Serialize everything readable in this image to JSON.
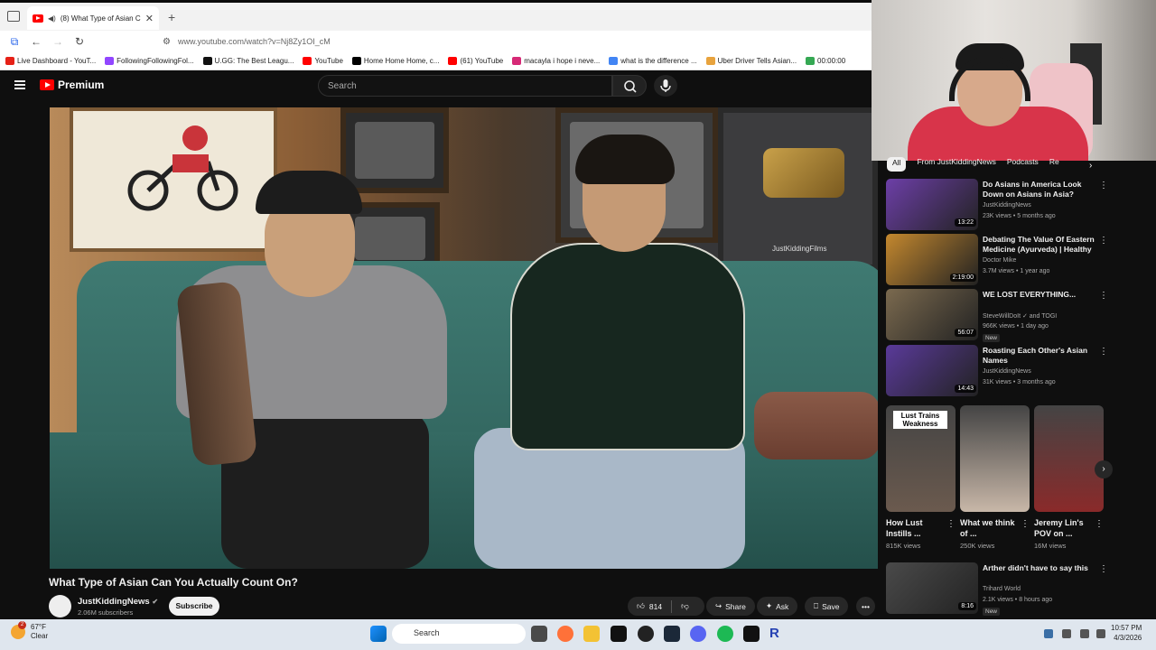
{
  "browser": {
    "tab_title": "(8) What Type of Asian Can",
    "url": "www.youtube.com/watch?v=Nj8Zy1OI_cM",
    "bookmarks": [
      {
        "label": "Live Dashboard - YouT...",
        "color": "#e62117"
      },
      {
        "label": "FollowingFollowingFol...",
        "color": "#9146ff"
      },
      {
        "label": "U.GG: The Best Leagu...",
        "color": "#111111"
      },
      {
        "label": "YouTube",
        "color": "#ff0000"
      },
      {
        "label": "Home Home Home, c...",
        "color": "#000000"
      },
      {
        "label": "(61) YouTube",
        "color": "#ff0000"
      },
      {
        "label": "macayla i hope i neve...",
        "color": "#d62976"
      },
      {
        "label": "what is the difference ...",
        "color": "#4285f4"
      },
      {
        "label": "Uber Driver Tells Asian...",
        "color": "#e8a33d"
      },
      {
        "label": "00:00:00",
        "color": "#35a853"
      }
    ]
  },
  "youtube": {
    "logo_text": "Premium",
    "search_placeholder": "Search"
  },
  "video": {
    "title": "What Type of Asian Can You Actually Count On?",
    "channel": "JustKiddingNews",
    "subscribers": "2.06M subscribers",
    "subscribe_label": "Subscribe",
    "likes": "814",
    "share_label": "Share",
    "ask_label": "Ask",
    "save_label": "Save",
    "overlay_text": "JustKiddingFilms"
  },
  "chips": [
    "All",
    "From JustKiddingNews",
    "Podcasts",
    "Re"
  ],
  "recommended": [
    {
      "title": "Do Asians in America Look Down on Asians in Asia?",
      "channel": "JustKiddingNews",
      "meta": "23K views • 5 months ago",
      "duration": "13:22",
      "thumb": "#6d3fa8",
      "new": ""
    },
    {
      "title": "Debating The Value Of Eastern Medicine (Ayurveda) | Healthy ...",
      "channel": "Doctor Mike",
      "meta": "3.7M views • 1 year ago",
      "duration": "2:19:00",
      "thumb": "#c4882e",
      "new": ""
    },
    {
      "title": "WE LOST EVERYTHING...",
      "channel": "SteveWillDoIt ✓ and TOGI",
      "meta": "966K views • 1 day ago",
      "duration": "56:07",
      "thumb": "#7b6a4f",
      "new": "New"
    },
    {
      "title": "Roasting Each Other's Asian Names",
      "channel": "JustKiddingNews",
      "meta": "31K views • 3 months ago",
      "duration": "14:43",
      "thumb": "#5a3a9a",
      "new": ""
    },
    {
      "title": "Arther didn't have to say this",
      "channel": "Trihard World",
      "meta": "2.1K views • 8 hours ago",
      "duration": "8:16",
      "thumb": "#4a4a4a",
      "new": "New"
    }
  ],
  "shorts": [
    {
      "title": "How Lust Instills ...",
      "views": "815K views",
      "overlay": "Lust Trains Weakness",
      "thumb": "#6b5a4e"
    },
    {
      "title": "What we think of ...",
      "views": "250K views",
      "overlay": "",
      "thumb": "#c8b7a8"
    },
    {
      "title": "Jeremy Lin's POV on ...",
      "views": "16M views",
      "overlay": "",
      "thumb": "#8a2a2a"
    }
  ],
  "taskbar": {
    "temp": "67°F",
    "condition": "Clear",
    "search": "Search",
    "time": "10:57 PM",
    "date": "4/3/2026",
    "notification_count": "2"
  }
}
